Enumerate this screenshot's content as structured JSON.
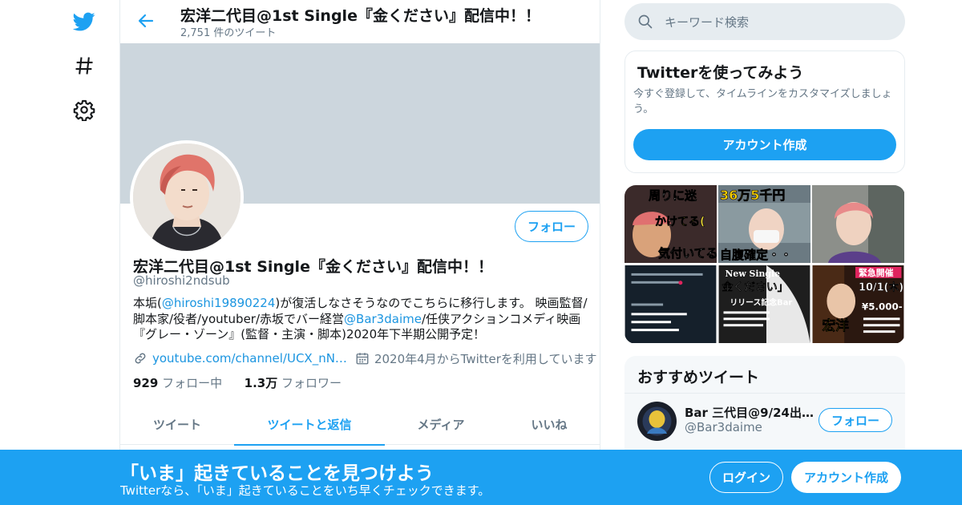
{
  "nav": {
    "icons": [
      "twitter-bird-icon",
      "hashtag-icon",
      "settings-gear-icon"
    ]
  },
  "header": {
    "title": "宏洋二代目@1st Single『金ください』配信中！！",
    "tweet_count": "2,751 件のツイート"
  },
  "profile": {
    "display_name": "宏洋二代目@1st Single『金ください』配信中！！",
    "handle": "@hiroshi2ndsub",
    "follow_label": "フォロー",
    "bio": {
      "p1": "本垢(",
      "mention1": "@hiroshi19890224",
      "p2": ")が復活しなさそうなのでこちらに移行します。 映画監督/脚本家/役者/youtuber/赤坂でバー経営",
      "mention2": "@Bar3daime",
      "p3": "/任侠アクションコメディ映画『グレー・ゾーン』(監督・主演・脚本)2020年下半期公開予定！"
    },
    "website": "youtube.com/channel/UCX_nN…",
    "joined": "2020年4月からTwitterを利用しています",
    "following_count": "929",
    "following_label": "フォロー中",
    "followers_count": "1.3万",
    "followers_label": "フォロワー"
  },
  "tabs": [
    {
      "label": "ツイート",
      "active": false
    },
    {
      "label": "ツイートと返信",
      "active": true
    },
    {
      "label": "メディア",
      "active": false
    },
    {
      "label": "いいね",
      "active": false
    }
  ],
  "search": {
    "placeholder": "キーワード検索"
  },
  "signup_card": {
    "title": "Twitterを使ってみよう",
    "description": "今すぐ登録して、タイムラインをカスタマイズしましょう。",
    "button": "アカウント作成"
  },
  "media_captions": {
    "m1a": "周りに迷",
    "m1b": "かけてる(",
    "m1c": "気付いてる",
    "m2a": "36万5千円",
    "m2b": "自腹確定・・",
    "m5a": "New Single",
    "m5b": "金ください」",
    "m5c": "リリース記念Bar",
    "m6a": "緊急開催",
    "m6b": "10/1(木)",
    "m6c": "¥5.000-",
    "m6d": "宏洋"
  },
  "recommended": {
    "title": "おすすめツイート",
    "name": "Bar 三代目@9/24出…",
    "handle": "@Bar3daime",
    "follow_label": "フォロー"
  },
  "bottom_bar": {
    "title": "「いま」起きていることを見つけよう",
    "subtitle": "Twitterなら、「いま」起きていることをいち早くチェックできます。",
    "login": "ログイン",
    "signup": "アカウント作成"
  },
  "colors": {
    "brand": "#1da1f2",
    "banner": "#ccd6dd",
    "link": "#1b95e0",
    "muted": "#657786"
  }
}
